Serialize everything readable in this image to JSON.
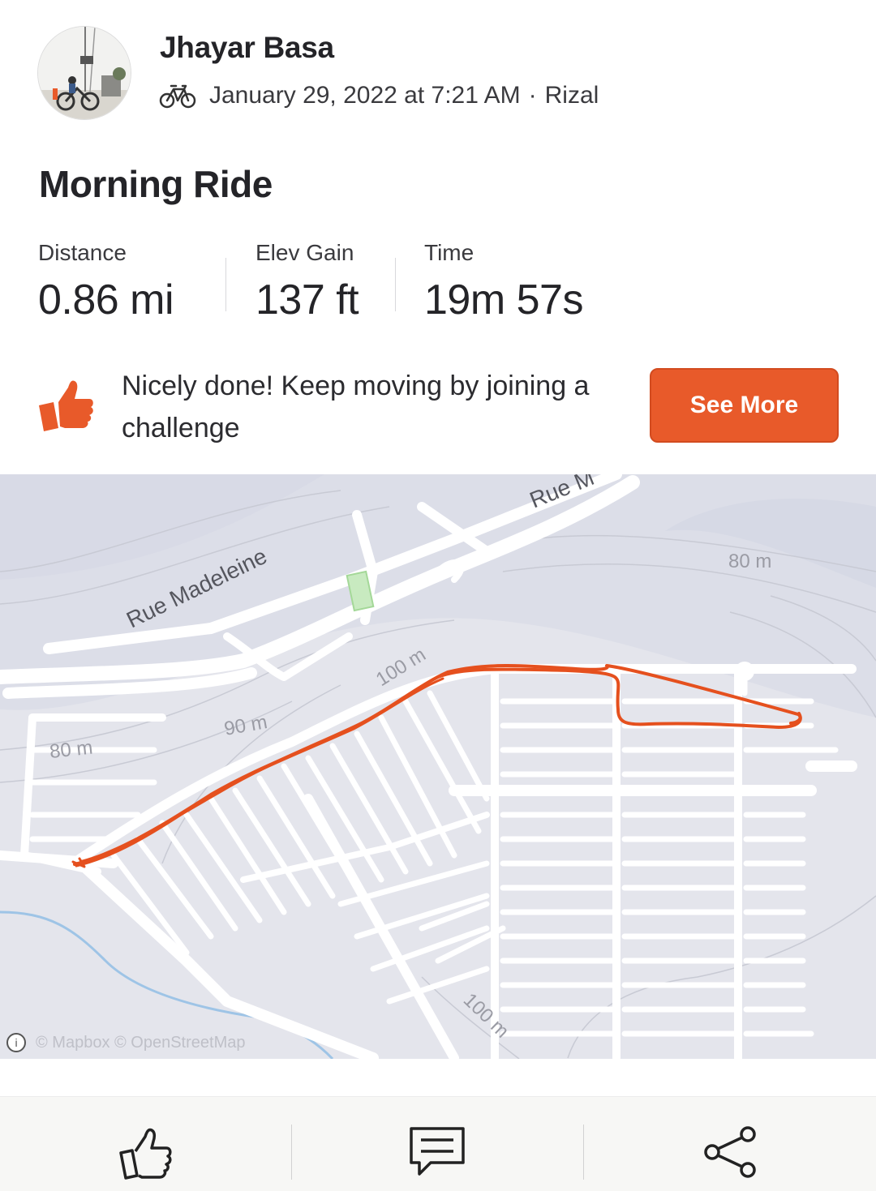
{
  "athlete": {
    "name": "Jhayar Basa",
    "activity_icon": "bike-icon",
    "date": "January 29, 2022 at 7:21 AM",
    "location": "Rizal"
  },
  "activity": {
    "title": "Morning Ride",
    "stats": [
      {
        "label": "Distance",
        "value": "0.86 mi"
      },
      {
        "label": "Elev Gain",
        "value": "137 ft"
      },
      {
        "label": "Time",
        "value": "19m 57s"
      }
    ]
  },
  "challenge": {
    "icon": "thumbs-up-icon",
    "message": "Nicely done! Keep moving by joining a challenge",
    "button_label": "See More"
  },
  "map": {
    "street_labels": [
      "Rue Madeleine",
      "Rue M"
    ],
    "contour_labels": [
      "80 m",
      "90 m",
      "100 m",
      "80 m",
      "100 m"
    ],
    "attribution": "© Mapbox © OpenStreetMap",
    "route_color": "#e5501e"
  },
  "toolbar": {
    "icons": [
      "kudos-icon",
      "comment-icon",
      "share-icon"
    ]
  },
  "colors": {
    "accent": "#e85a2a",
    "text": "#242428"
  }
}
